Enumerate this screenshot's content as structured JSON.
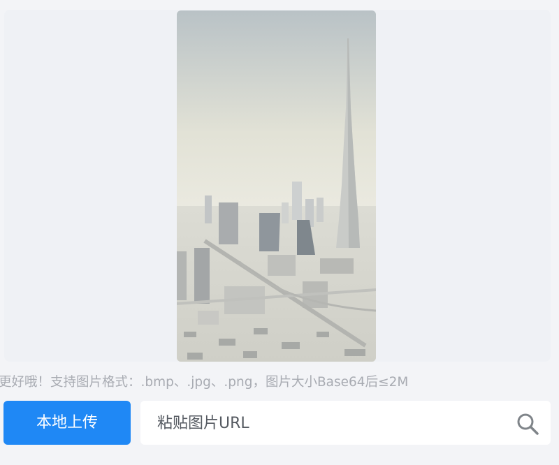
{
  "preview": {
    "image_description": "city-skyline-photo"
  },
  "hint": {
    "text": "更好哦！支持图片格式：.bmp、.jpg、.png，图片大小Base64后≤2M"
  },
  "upload": {
    "label": "本地上传"
  },
  "url_input": {
    "placeholder": "粘贴图片URL",
    "value": ""
  },
  "icons": {
    "search": "search-icon"
  },
  "colors": {
    "primary": "#1f88f5",
    "hint_text": "#a8abb2",
    "panel_bg": "#eff1f5"
  }
}
